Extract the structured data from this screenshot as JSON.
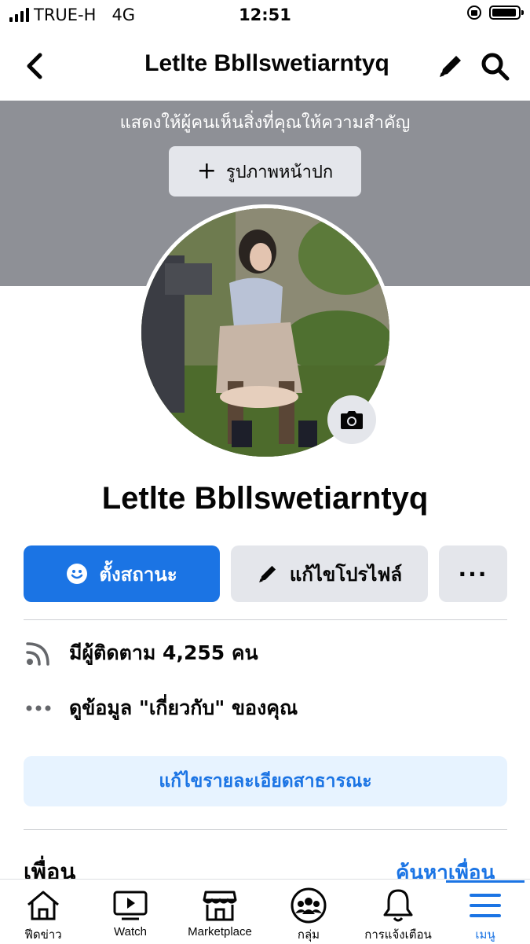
{
  "status_bar": {
    "carrier": "TRUE-H",
    "network": "4G",
    "time": "12:51"
  },
  "top_nav": {
    "title": "Letlte Bbllswetiarntyq"
  },
  "cover": {
    "hint": "แสดงให้ผู้คนเห็นสิ่งที่คุณให้ความสำคัญ",
    "add_cover_label": "รูปภาพหน้าปก"
  },
  "profile": {
    "name": "Letlte Bbllswetiarntyq"
  },
  "actions": {
    "status_label": "ตั้งสถานะ",
    "edit_profile_label": "แก้ไขโปรไฟล์",
    "more_label": "···"
  },
  "info": {
    "followers": "มีผู้ติดตาม 4,255 คน",
    "about": "ดูข้อมูล \"เกี่ยวกับ\" ของคุณ"
  },
  "edit_public_label": "แก้ไขรายละเอียดสาธารณะ",
  "friends": {
    "title": "เพื่อน",
    "find_label": "ค้นหาเพื่อน"
  },
  "bottom_nav": {
    "items": [
      {
        "label": "ฟีดข่าว",
        "icon": "home-icon"
      },
      {
        "label": "Watch",
        "icon": "watch-icon"
      },
      {
        "label": "Marketplace",
        "icon": "marketplace-icon"
      },
      {
        "label": "กลุ่ม",
        "icon": "groups-icon"
      },
      {
        "label": "การแจ้งเตือน",
        "icon": "bell-icon"
      },
      {
        "label": "เมนู",
        "icon": "menu-icon"
      }
    ],
    "active_index": 5
  },
  "colors": {
    "accent": "#1b74e4",
    "cover": "#8e9096",
    "button_gray": "#e4e6eb",
    "light_blue": "#e7f3ff"
  }
}
